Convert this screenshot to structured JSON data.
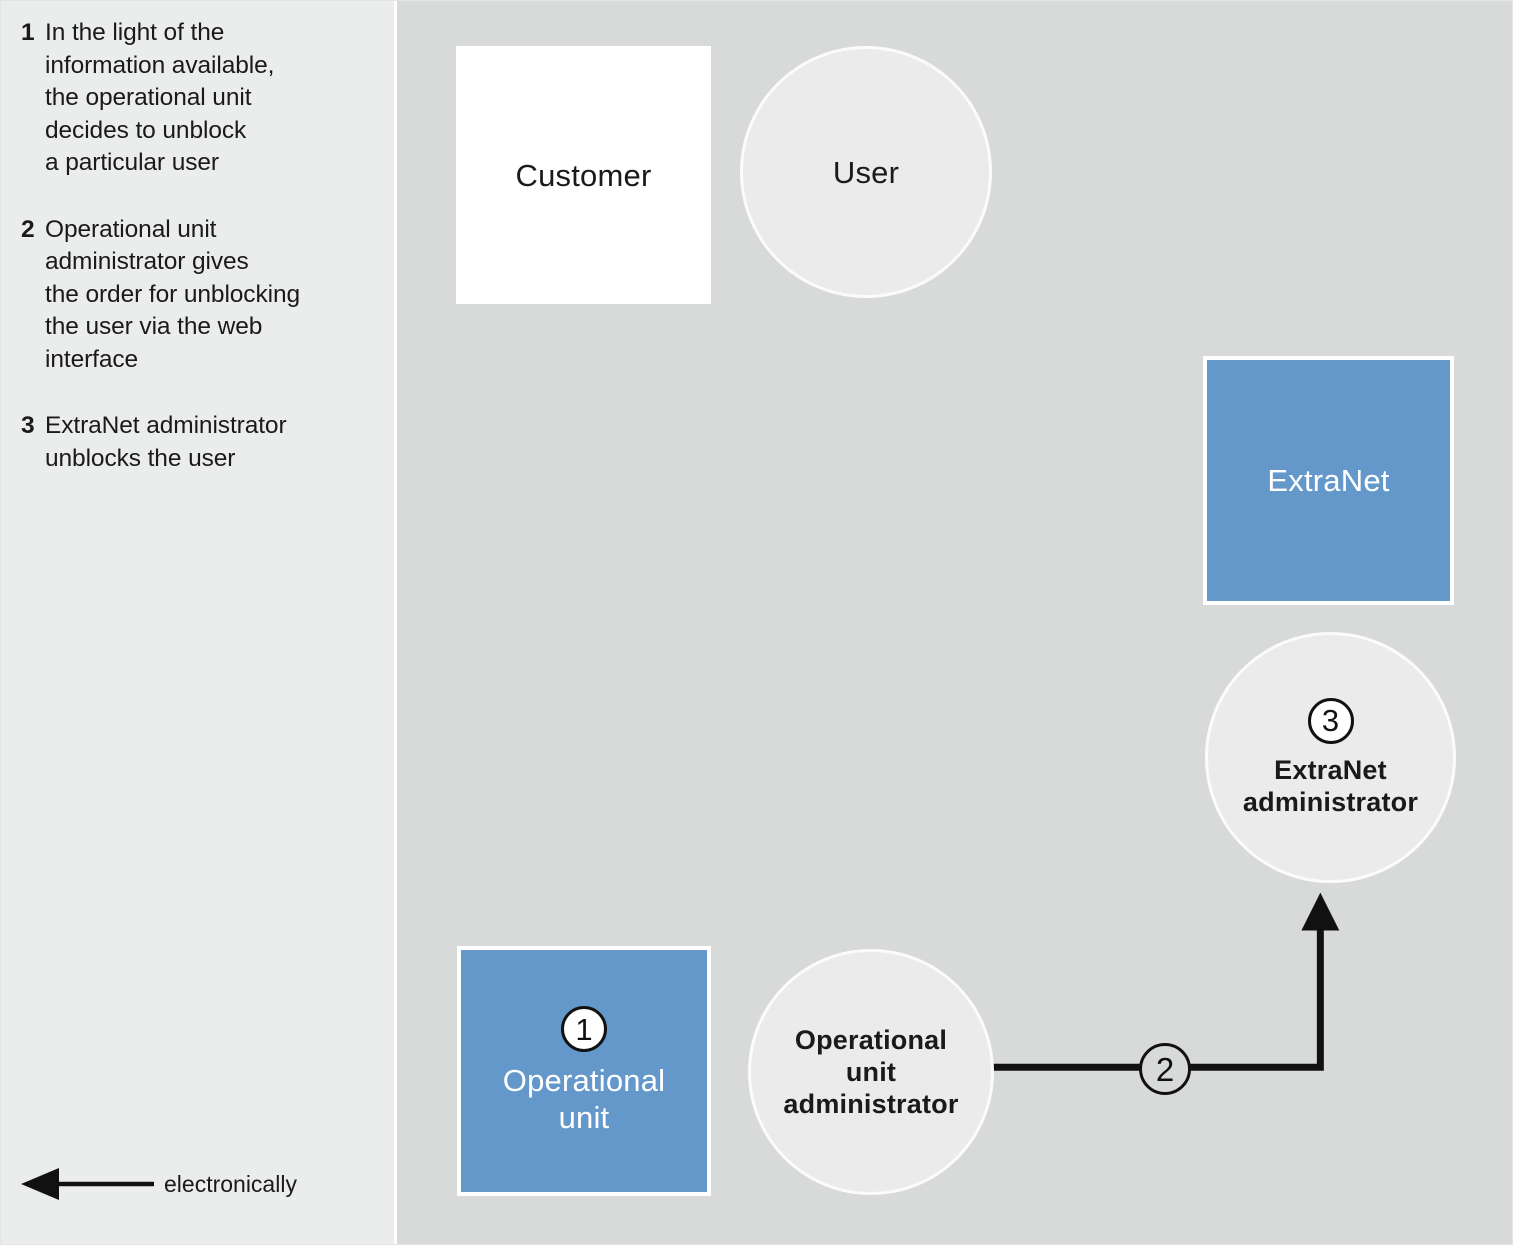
{
  "sidebar": {
    "steps": [
      {
        "number": "1",
        "text": "In the light of the\ninformation available,\nthe operational unit\ndecides to unblock\na particular user"
      },
      {
        "number": "2",
        "text": "Operational unit\nadministrator gives\nthe order for unblocking\nthe user via the web\ninterface"
      },
      {
        "number": "3",
        "text": "ExtraNet administrator\nunblocks the user"
      }
    ],
    "legend": {
      "icon": "left-arrow-icon",
      "label": "electronically"
    }
  },
  "diagram": {
    "nodes": {
      "customer": {
        "label": "Customer",
        "shape": "rect",
        "fill": "#ffffff"
      },
      "user": {
        "label": "User",
        "shape": "circle",
        "fill": "#ebebeb"
      },
      "extranet": {
        "label": "ExtraNet",
        "shape": "rect",
        "fill": "#6598ca"
      },
      "extranet_admin": {
        "label": "ExtraNet\nadministrator",
        "badge": "3",
        "shape": "circle",
        "fill": "#ebebeb"
      },
      "operational_unit": {
        "label": "Operational\nunit",
        "badge": "1",
        "shape": "rect",
        "fill": "#6598ca"
      },
      "operational_unit_admin": {
        "label": "Operational\nunit\nadministrator",
        "shape": "circle",
        "fill": "#ebebeb"
      }
    },
    "connectors": [
      {
        "from": "operational_unit_admin",
        "to": "extranet_admin",
        "badge": "2",
        "style": "electronically",
        "arrow": "end"
      }
    ],
    "colors": {
      "accent_blue": "#6598ca",
      "panel_background": "#d8d9d9",
      "sidebar_background": "#ebedec",
      "circle_fill": "#ebebeb",
      "line": "#111111"
    }
  }
}
